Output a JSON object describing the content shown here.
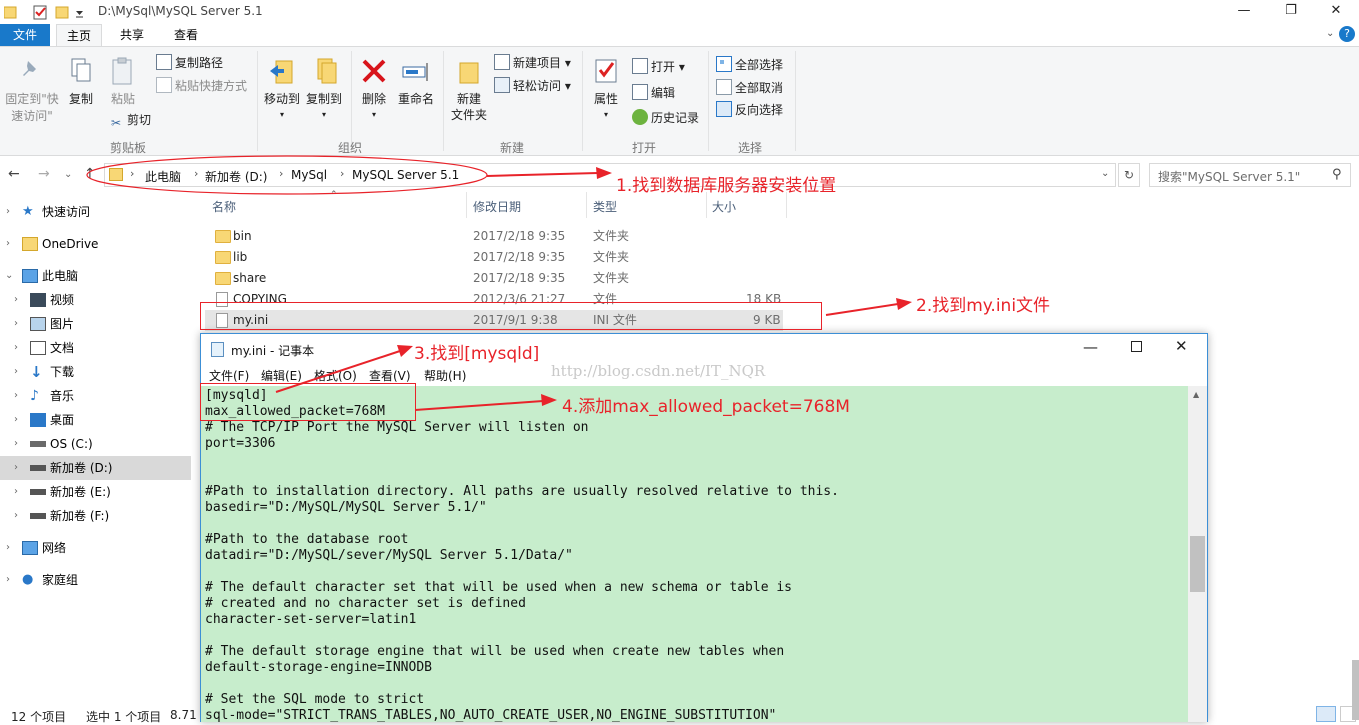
{
  "window": {
    "path": "D:\\MySql\\MySQL Server 5.1",
    "minimize": "—",
    "maximize": "❐",
    "close": "✕"
  },
  "tabs": [
    "文件",
    "主页",
    "共享",
    "查看"
  ],
  "ribbon": {
    "pin": "固定到\"快\n速访问\"",
    "copy": "复制",
    "paste": "粘贴",
    "copy_path": "复制路径",
    "paste_shortcut": "粘贴快捷方式",
    "cut": "剪切",
    "group_clipboard": "剪贴板",
    "move_to": "移动到",
    "copy_to": "复制到",
    "delete": "删除",
    "rename": "重命名",
    "group_organize": "组织",
    "new_folder": "新建\n文件夹",
    "new_item": "新建项目",
    "easy_access": "轻松访问",
    "group_new": "新建",
    "properties": "属性",
    "open": "打开",
    "edit": "编辑",
    "history": "历史记录",
    "group_open": "打开",
    "select_all": "全部选择",
    "select_none": "全部取消",
    "invert_selection": "反向选择",
    "group_select": "选择"
  },
  "address": {
    "crumbs": [
      "此电脑",
      "新加卷 (D:)",
      "MySql",
      "MySQL Server 5.1"
    ],
    "search_placeholder": "搜索\"MySQL Server 5.1\""
  },
  "nav_pane": [
    {
      "label": "快速访问",
      "icon": "star-icon"
    },
    {
      "label": "OneDrive",
      "icon": "folder-icon"
    },
    {
      "label": "此电脑",
      "icon": "computer-icon"
    },
    {
      "label": "视频",
      "icon": "video-icon"
    },
    {
      "label": "图片",
      "icon": "picture-icon"
    },
    {
      "label": "文档",
      "icon": "document-icon"
    },
    {
      "label": "下载",
      "icon": "download-icon"
    },
    {
      "label": "音乐",
      "icon": "music-icon"
    },
    {
      "label": "桌面",
      "icon": "desktop-icon"
    },
    {
      "label": "OS (C:)",
      "icon": "drive-icon"
    },
    {
      "label": "新加卷 (D:)",
      "icon": "drive-icon"
    },
    {
      "label": "新加卷 (E:)",
      "icon": "drive-icon"
    },
    {
      "label": "新加卷 (F:)",
      "icon": "drive-icon"
    },
    {
      "label": "网络",
      "icon": "network-icon"
    },
    {
      "label": "家庭组",
      "icon": "homegroup-icon"
    }
  ],
  "columns": {
    "name": "名称",
    "date": "修改日期",
    "type": "类型",
    "size": "大小"
  },
  "files": [
    {
      "name": "bin",
      "date": "2017/2/18 9:35",
      "type": "文件夹",
      "size": ""
    },
    {
      "name": "lib",
      "date": "2017/2/18 9:35",
      "type": "文件夹",
      "size": ""
    },
    {
      "name": "share",
      "date": "2017/2/18 9:35",
      "type": "文件夹",
      "size": ""
    },
    {
      "name": "COPYING",
      "date": "2012/3/6 21:27",
      "type": "文件",
      "size": "18 KB"
    },
    {
      "name": "my.ini",
      "date": "2017/9/1 9:38",
      "type": "INI 文件",
      "size": "9 KB"
    }
  ],
  "status": {
    "count": "12 个项目",
    "selected": "选中 1 个项目",
    "size": "8.71"
  },
  "notepad": {
    "title": "my.ini - 记事本",
    "menu": [
      "文件(F)",
      "编辑(E)",
      "格式(O)",
      "查看(V)",
      "帮助(H)"
    ],
    "content": "[mysqld]\nmax_allowed_packet=768M\n# The TCP/IP Port the MySQL Server will listen on\nport=3306\n\n\n#Path to installation directory. All paths are usually resolved relative to this.\nbasedir=\"D:/MySQL/MySQL Server 5.1/\"\n\n#Path to the database root\ndatadir=\"D:/MySQL/sever/MySQL Server 5.1/Data/\"\n\n# The default character set that will be used when a new schema or table is\n# created and no character set is defined\ncharacter-set-server=latin1\n\n# The default storage engine that will be used when create new tables when\ndefault-storage-engine=INNODB\n\n# Set the SQL mode to strict\nsql-mode=\"STRICT_TRANS_TABLES,NO_AUTO_CREATE_USER,NO_ENGINE_SUBSTITUTION\""
  },
  "annotations": {
    "step1": "1.找到数据库服务器安装位置",
    "step2": "2.找到my.ini文件",
    "step3": "3.找到[mysqld]",
    "step4": "4.添加max_allowed_packet=768M",
    "watermark": "http://blog.csdn.net/IT_NQR"
  },
  "colors": {
    "accent": "#1979ca",
    "annotation": "#e8232a",
    "editor_bg": "#c7edcc"
  }
}
